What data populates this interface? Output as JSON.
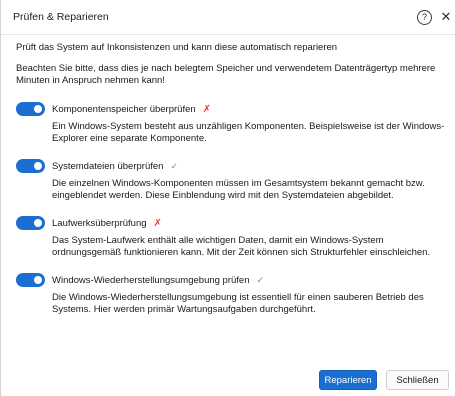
{
  "window": {
    "title": "Prüfen & Reparieren",
    "help_symbol": "?",
    "close_symbol": "✕"
  },
  "intro": "Prüft das System auf Inkonsistenzen und kann diese automatisch reparieren",
  "note": "Beachten Sie bitte, dass dies je nach belegtem Speicher und verwendetem Datenträgertyp mehrere Minuten in Anspruch nehmen kann!",
  "options": [
    {
      "label": "Komponentenspeicher überprüfen",
      "enabled": true,
      "status": "✗",
      "status_type": "fail",
      "description": "Ein Windows-System besteht aus unzähligen Komponenten. Beispielsweise ist der Windows-Explorer eine separate Komponente."
    },
    {
      "label": "Systemdateien überprüfen",
      "enabled": true,
      "status": "✓",
      "status_type": "ok",
      "description": "Die einzelnen Windows-Komponenten müssen im Gesamtsystem bekannt gemacht bzw. eingeblendet werden. Diese Einblendung wird mit den Systemdateien abgebildet."
    },
    {
      "label": "Laufwerksüberprüfung",
      "enabled": true,
      "status": "✗",
      "status_type": "fail",
      "description": "Das System-Laufwerk enthält alle wichtigen Daten, damit ein Windows-System ordnungsgemäß funktionieren kann. Mit der Zeit können sich Strukturfehler einschleichen."
    },
    {
      "label": "Windows-Wiederherstellungsumgebung prüfen",
      "enabled": true,
      "status": "✓",
      "status_type": "ok",
      "description": "Die Windows-Wiederherstellungsumgebung ist essentiell für einen sauberen Betrieb des Systems. Hier werden primär Wartungsaufgaben durchgeführt."
    }
  ],
  "buttons": {
    "repair": "Reparieren",
    "close": "Schließen"
  },
  "colors": {
    "accent": "#1a6fd1",
    "fail": "#e23b3b",
    "ok": "#4caf50"
  }
}
